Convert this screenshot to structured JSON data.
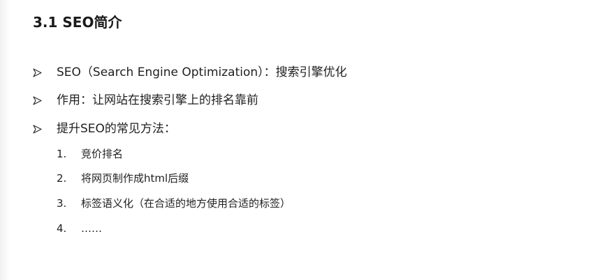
{
  "document": {
    "title": "3.1 SEO简介",
    "bullets": [
      {
        "icon": "arrowhead-bullet-icon",
        "text": "SEO（Search Engine Optimization）：搜索引擎优化"
      },
      {
        "icon": "arrowhead-bullet-icon",
        "text": "作用：让网站在搜索引擎上的排名靠前"
      },
      {
        "icon": "arrowhead-bullet-icon",
        "text": "提升SEO的常见方法："
      }
    ],
    "methods": [
      {
        "number": "1.",
        "text": "竞价排名"
      },
      {
        "number": "2.",
        "text": "将网页制作成html后缀"
      },
      {
        "number": "3.",
        "text": "标签语义化（在合适的地方使用合适的标签）"
      },
      {
        "number": "4.",
        "text": "……"
      }
    ]
  }
}
